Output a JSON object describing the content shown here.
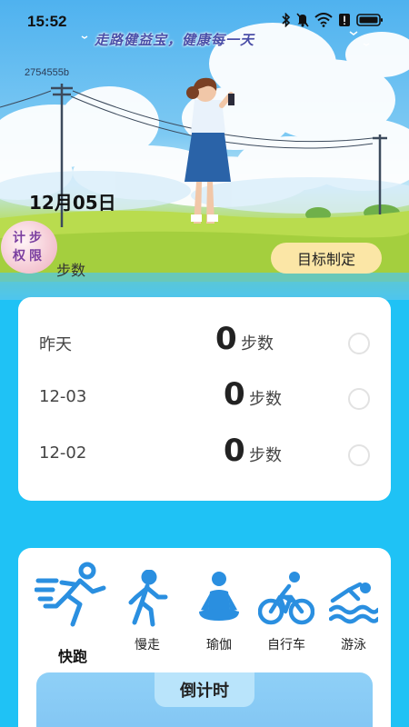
{
  "status_bar": {
    "time": "15:52",
    "icons": [
      "bluetooth-icon",
      "mute-icon",
      "wifi-icon",
      "alert-icon",
      "battery-icon"
    ]
  },
  "hero": {
    "slogan": "走路健益宝，健康每一天",
    "device_id": "2754555b",
    "date": "12月05日",
    "permission_badge": {
      "line1": "计步",
      "line2": "权限"
    },
    "steps_unit": "步数",
    "goal_button": "目标制定"
  },
  "history": {
    "rows": [
      {
        "label": "昨天",
        "value": "0",
        "unit": "步数"
      },
      {
        "label": "12-03",
        "value": "0",
        "unit": "步数"
      },
      {
        "label": "12-02",
        "value": "0",
        "unit": "步数"
      }
    ]
  },
  "exercise": {
    "items": [
      {
        "label": "快跑",
        "icon": "running-icon"
      },
      {
        "label": "慢走",
        "icon": "walking-icon"
      },
      {
        "label": "瑜伽",
        "icon": "yoga-icon"
      },
      {
        "label": "自行车",
        "icon": "cycling-icon"
      },
      {
        "label": "游泳",
        "icon": "swimming-icon"
      }
    ],
    "countdown_title": "倒计时"
  },
  "colors": {
    "background": "#1fc2f5",
    "icon_blue": "#2a8fe0",
    "goal_button": "#fbe6a6",
    "permission_text": "#7b3fa0"
  }
}
